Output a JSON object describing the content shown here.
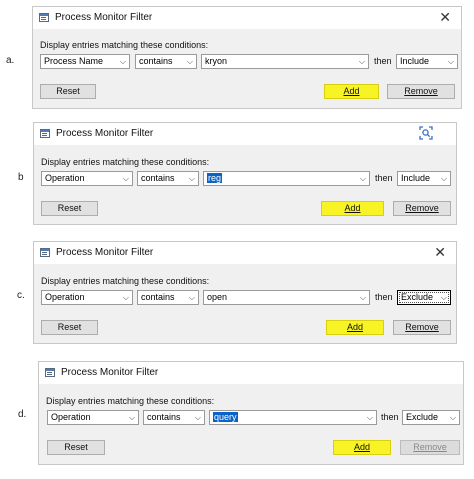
{
  "common": {
    "dialog_title": "Process Monitor Filter",
    "conditions_label": "Display entries matching these conditions:",
    "then_label": "then",
    "reset_label": "Reset",
    "add_label": "Add",
    "remove_label": "Remove",
    "close_glyph": "✕"
  },
  "steps": [
    {
      "letter": "a.",
      "column": "Process Name",
      "relation": "contains",
      "value": "kryon",
      "action": "Include"
    },
    {
      "letter": "b",
      "column": "Operation",
      "relation": "contains",
      "value": "reg",
      "action": "Include"
    },
    {
      "letter": "c.",
      "column": "Operation",
      "relation": "contains",
      "value": "open",
      "action": "Exclude"
    },
    {
      "letter": "d.",
      "column": "Operation",
      "relation": "contains",
      "value": "query",
      "action": "Exclude"
    }
  ],
  "colors": {
    "highlight": "#f7f325",
    "selection": "#0a64c8",
    "dialog_bg": "#f0f0f0"
  },
  "icons": {
    "app": "process-monitor-app-icon",
    "close": "close-icon",
    "lens": "visual-search-icon"
  }
}
